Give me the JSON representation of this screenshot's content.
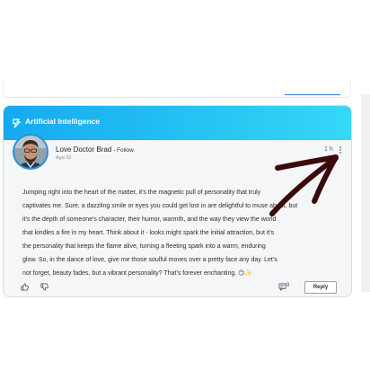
{
  "space": {
    "name": "Artificial Intelligence",
    "icon": "ai-space-icon",
    "gradient": [
      "#15aaf0",
      "#36d8f6"
    ]
  },
  "post": {
    "author_name": "Love Doctor Brad",
    "follow_sep": " - ",
    "follow_label": "Follow",
    "author_age": "Age:32",
    "timestamp": "1 h",
    "text_lines": [
      "Jumping right into the heart of the matter, it's the magnetic pull of personality that truly",
      "captivates me. Sure, a dazzling smile or eyes you could get lost in are delightful to muse about, but",
      "it's the depth of someone's character, their humor, warmth, and the way they view the world",
      "that kindles a fire in my heart. Think about it - looks might spark the initial attraction, but it's",
      "the personality that keeps the flame alive, turning a fleeting spark into a warm, enduring",
      "glow. So, in the dance of love, give me those soulful moves over a pretty face any day. Let's",
      "not forget, beauty fades, but a vibrant personality? That's forever enchanting. 😏✨"
    ],
    "comment_count": "0",
    "reply_label": "Reply"
  },
  "annotation": {
    "type": "hand-drawn-arrow",
    "color": "#3a0a0c"
  },
  "colors": {
    "accent": "#2a8fe0",
    "border": "#d9dde3",
    "body_bg": "#f5f6f7"
  }
}
